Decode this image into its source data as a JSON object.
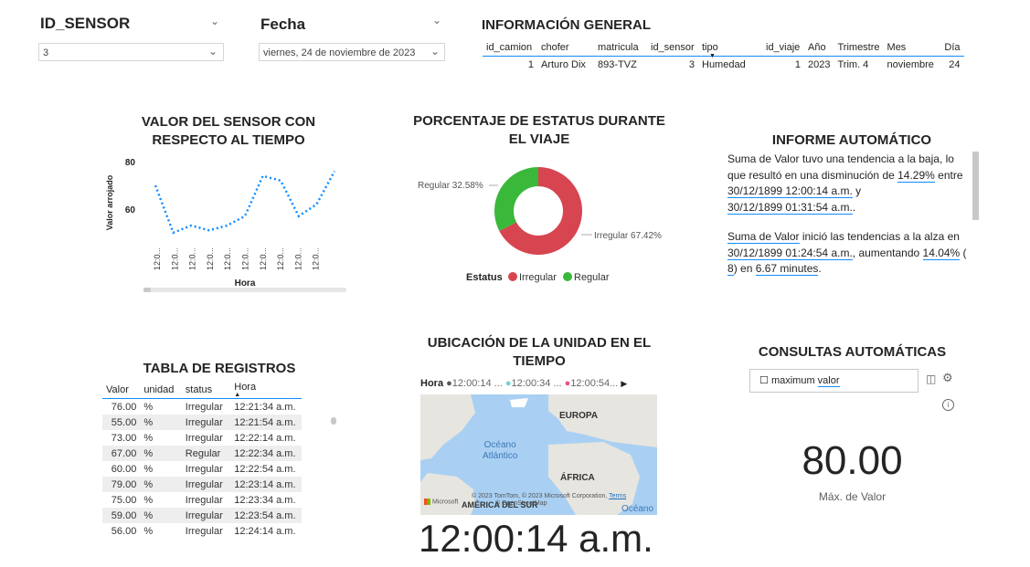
{
  "slicers": {
    "sensor": {
      "title": "ID_SENSOR",
      "value": "3"
    },
    "fecha": {
      "title": "Fecha",
      "value": "viernes, 24 de noviembre de 2023"
    }
  },
  "info": {
    "title": "INFORMACIÓN GENERAL",
    "headers": [
      "id_camion",
      "chofer",
      "matricula",
      "id_sensor",
      "tipo",
      "id_viaje",
      "Año",
      "Trimestre",
      "Mes",
      "Día"
    ],
    "row": [
      "1",
      "Arturo Dix",
      "893-TVZ",
      "3",
      "Humedad",
      "1",
      "2023",
      "Trim. 4",
      "noviembre",
      "24"
    ]
  },
  "line_chart": {
    "title_line1": "VALOR DEL SENSOR CON",
    "title_line2": "RESPECTO AL TIEMPO",
    "ylabel": "Valor arrojado",
    "xlabel": "Hora",
    "tick_labels": [
      "12:0...",
      "12:0...",
      "12:0...",
      "12:0...",
      "12:0...",
      "12:0...",
      "12:0...",
      "12:0...",
      "12:0...",
      "12:0..."
    ]
  },
  "chart_data": [
    {
      "type": "line",
      "title": "VALOR DEL SENSOR CON RESPECTO AL TIEMPO",
      "xlabel": "Hora",
      "ylabel": "Valor arrojado",
      "yticks": [
        60,
        80
      ],
      "ylim": [
        48,
        82
      ],
      "grid": false,
      "series": [
        {
          "values": [
            70,
            50,
            53,
            51,
            53,
            57,
            74,
            72,
            57,
            62,
            76
          ]
        }
      ]
    },
    {
      "type": "pie",
      "title": "PORCENTAJE DE ESTATUS DURANTE EL VIAJE",
      "legend_title": "Estatus",
      "legend_position": "bottom",
      "categories": [
        "Irregular",
        "Regular"
      ],
      "values": [
        67.42,
        32.58
      ],
      "colors": [
        "#d64550",
        "#3ab83a"
      ]
    }
  ],
  "donut": {
    "title_line1": "PORCENTAJE DE ESTATUS DURANTE",
    "title_line2": "EL VIAJE",
    "label_regular": "Regular 32.58%",
    "label_irregular": "Irregular 67.42%",
    "legend_title": "Estatus",
    "legend_items": [
      "Irregular",
      "Regular"
    ]
  },
  "informe": {
    "title": "INFORME AUTOMÁTICO",
    "p1": [
      "Suma de Valor tuvo una tendencia a la baja, lo",
      "que resultó en una disminución de ",
      "14.29%",
      " entre",
      "30/12/1899 12:00:14 a.m.",
      " y",
      "30/12/1899 01:31:54 a.m.",
      "."
    ],
    "p2": [
      "Suma de Valor",
      " inició las tendencias a la alza en",
      "30/12/1899 01:24:54 a.m.",
      ", aumentando ",
      "14.04%",
      " (",
      "8",
      ") en ",
      "6.67 minutes",
      "."
    ]
  },
  "registros": {
    "title": "TABLA DE REGISTROS",
    "headers": [
      "Valor",
      "unidad",
      "status",
      "Hora"
    ],
    "rows": [
      [
        "76.00",
        "%",
        "Irregular",
        "12:21:34 a.m."
      ],
      [
        "55.00",
        "%",
        "Irregular",
        "12:21:54 a.m."
      ],
      [
        "73.00",
        "%",
        "Irregular",
        "12:22:14 a.m."
      ],
      [
        "67.00",
        "%",
        "Regular",
        "12:22:34 a.m."
      ],
      [
        "60.00",
        "%",
        "Irregular",
        "12:22:54 a.m."
      ],
      [
        "79.00",
        "%",
        "Irregular",
        "12:23:14 a.m."
      ],
      [
        "75.00",
        "%",
        "Irregular",
        "12:23:34 a.m."
      ],
      [
        "59.00",
        "%",
        "Irregular",
        "12:23:54 a.m."
      ],
      [
        "56.00",
        "%",
        "Irregular",
        "12:24:14 a.m."
      ]
    ]
  },
  "mapa": {
    "title_line1": "UBICACIÓN DE LA UNIDAD EN EL",
    "title_line2": "TIEMPO",
    "legend_title": "Hora",
    "legend_items": [
      "12:00:14 ...",
      "12:00:34 ...",
      "12:00:54..."
    ],
    "legend_colors": [
      "#555555",
      "#6fd3d3",
      "#e8557a"
    ],
    "labels": {
      "europa": "EUROPA",
      "oceano": "Océano",
      "atlantico": "Atlántico",
      "africa": "ÁFRICA",
      "america": "AMÉRICA DEL SUR",
      "oceano2": "Océano"
    },
    "attribution": "© 2023 TomTom, © 2023 Microsoft Corporation, ",
    "terms": "Terms",
    "osm": "© OpenStreetMap",
    "microsoft": "Microsoft",
    "time_card": "12:00:14 a.m."
  },
  "consultas": {
    "title": "CONSULTAS AUTOMÁTICAS",
    "query_word1": "maximum",
    "query_word2": "valor",
    "value": "80.00",
    "value_label": "Máx. de Valor"
  }
}
